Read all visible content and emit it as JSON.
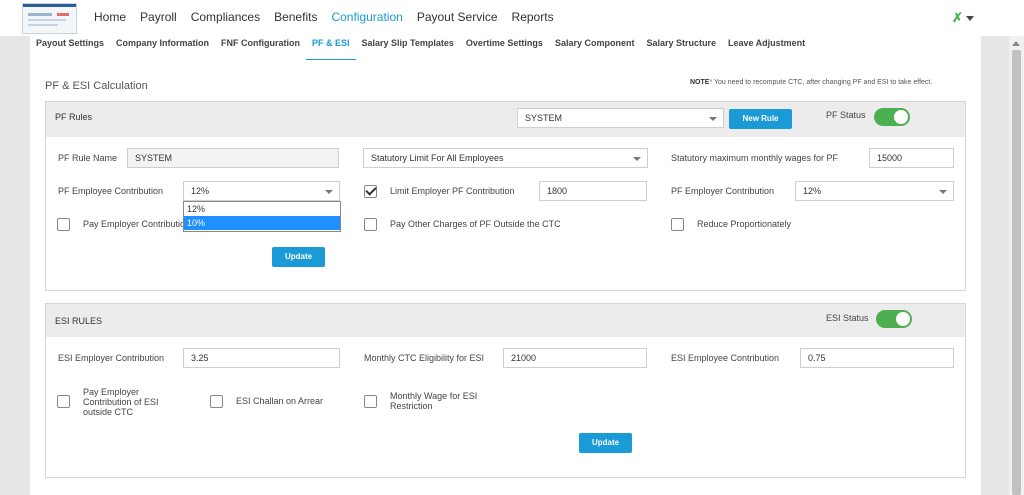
{
  "nav": {
    "items": [
      "Home",
      "Payroll",
      "Compliances",
      "Benefits",
      "Configuration",
      "Payout Service",
      "Reports"
    ],
    "active_index": 4
  },
  "tabs": {
    "items": [
      "Payout Settings",
      "Company Information",
      "FNF Configuration",
      "PF & ESI",
      "Salary Slip Templates",
      "Overtime Settings",
      "Salary Component",
      "Salary Structure",
      "Leave Adjustment"
    ],
    "active_index": 3
  },
  "page": {
    "title": "PF & ESI Calculation",
    "note_label": "NOTE",
    "note_star": "*",
    "note_text": " You need to recompute CTC, after changing PF and ESI to take effect."
  },
  "pf": {
    "panel_title": "PF Rules",
    "rule_select": "SYSTEM",
    "new_rule_label": "New Rule",
    "status_label": "PF Status",
    "status_on": true,
    "rule_name_label": "PF Rule Name",
    "rule_name_value": "SYSTEM",
    "limit_select": "Statutory Limit For All Employees",
    "max_wages_label": "Statutory maximum monthly wages for PF",
    "max_wages_value": "15000",
    "employee_contrib_label": "PF Employee Contribution",
    "employee_contrib_value": "12%",
    "employee_contrib_options": [
      "12%",
      "10%"
    ],
    "employee_contrib_highlighted": "10%",
    "limit_employer_label": "Limit Employer PF Contribution",
    "limit_employer_checked": true,
    "limit_employer_value": "1800",
    "employer_contrib_label": "PF Employer Contribution",
    "employer_contrib_value": "12%",
    "pay_employer_label": "Pay Employer Contribution outside the CTC",
    "pay_employer_checked": false,
    "pay_other_label": "Pay Other Charges of PF Outside the CTC",
    "pay_other_checked": false,
    "reduce_label": "Reduce Proportionately",
    "reduce_checked": false,
    "update_label": "Update"
  },
  "esi": {
    "panel_title": "ESI RULES",
    "status_label": "ESI Status",
    "status_on": true,
    "employer_contrib_label": "ESI Employer Contribution",
    "employer_contrib_value": "3.25",
    "ctc_eligibility_label": "Monthly CTC Eligibility for ESI",
    "ctc_eligibility_value": "21000",
    "employee_contrib_label": "ESI Employee Contribution",
    "employee_contrib_value": "0.75",
    "pay_employer_label": "Pay Employer Contribution of ESI outside CTC",
    "pay_employer_checked": false,
    "challan_label": "ESI Challan on Arrear",
    "challan_checked": false,
    "monthly_wage_label": "Monthly Wage for ESI Restriction",
    "monthly_wage_checked": false,
    "update_label": "Update"
  }
}
